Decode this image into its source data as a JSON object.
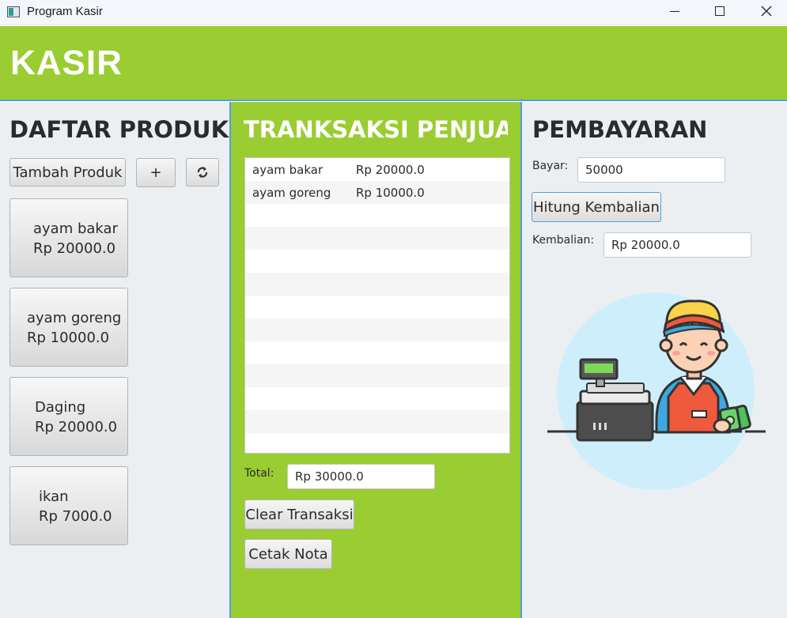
{
  "window": {
    "title": "Program Kasir",
    "controls": {
      "minimize": "minimize-icon",
      "maximize": "maximize-icon",
      "close": "close-icon"
    }
  },
  "header": {
    "title": "KASIR"
  },
  "colors": {
    "accent_green": "#9acd32",
    "border_blue": "#4f9fe0",
    "panel_grey": "#eceff1"
  },
  "daftar_produk": {
    "heading": "DAFTAR PRODUK",
    "tambah_label": "Tambah Produk",
    "plus_label": "+",
    "refresh_icon": "refresh-icon",
    "products": [
      {
        "name": "ayam bakar",
        "price": "Rp 20000.0"
      },
      {
        "name": "ayam goreng",
        "price": "Rp 10000.0"
      },
      {
        "name": "Daging",
        "price": "Rp 20000.0"
      },
      {
        "name": "ikan",
        "price": "Rp 7000.0"
      }
    ]
  },
  "transaksi": {
    "heading": "TRANKSAKSI PENJUA...",
    "items": [
      {
        "name": "ayam bakar",
        "price": "Rp 20000.0"
      },
      {
        "name": "ayam goreng",
        "price": "Rp 10000.0"
      }
    ],
    "total_label": "Total:",
    "total_value": "Rp 30000.0",
    "clear_label": "Clear Transaksi",
    "cetak_label": "Cetak Nota"
  },
  "pembayaran": {
    "heading": "PEMBAYARAN",
    "bayar_label": "Bayar:",
    "bayar_value": "50000",
    "hitung_label": "Hitung Kembalian",
    "kembalian_label": "Kembalian:",
    "kembalian_value": "Rp 20000.0",
    "illustration": "cashier-illustration"
  }
}
